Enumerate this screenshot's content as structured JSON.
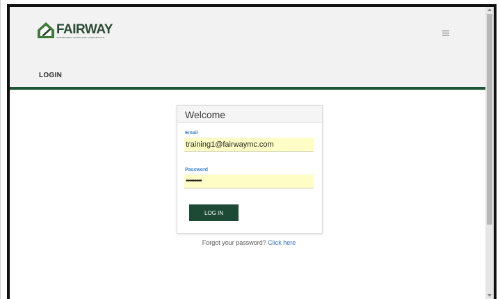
{
  "brand": {
    "name": "FAIRWAY",
    "tagline": "INDEPENDENT MORTGAGE CORPORATION",
    "color": "#2b4b34"
  },
  "nav": {
    "login_label": "LOGIN",
    "menu_icon": "hamburger-icon"
  },
  "accent_bar_color": "#1e5635",
  "card": {
    "title": "Welcome",
    "email_label": "Email",
    "email_value": "training1@fairwaymc.com",
    "password_label": "Password",
    "password_value": "123456789",
    "submit_label": "LOG IN",
    "button_color": "#1c4a35",
    "field_fill": "#fdfdc5"
  },
  "forgot": {
    "text": "Forgot your password?",
    "link": "Click here"
  }
}
